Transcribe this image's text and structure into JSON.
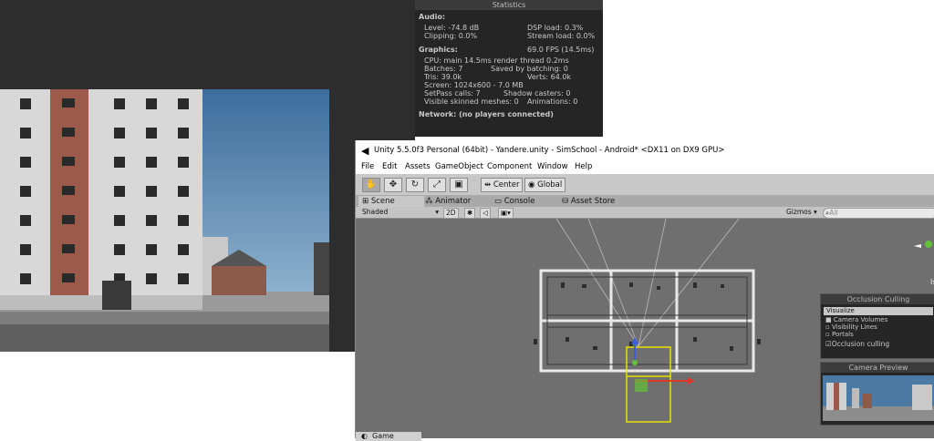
{
  "stats": {
    "title": "Statistics",
    "audio_header": "Audio:",
    "level": "Level: -74.8 dB",
    "dsp": "DSP load: 0.3%",
    "clipping": "Clipping: 0.0%",
    "stream": "Stream load: 0.0%",
    "graphics_header": "Graphics:",
    "fps": "69.0 FPS (14.5ms)",
    "cpu": "CPU: main 14.5ms  render thread 0.2ms",
    "batches": "Batches: 7",
    "saved": "Saved by batching: 0",
    "tris": "Tris: 39.0k",
    "verts": "Verts: 64.0k",
    "screen": "Screen: 1024x600 - 7.0 MB",
    "setpass": "SetPass calls: 7",
    "shadow": "Shadow casters: 0",
    "skinned": "Visible skinned meshes: 0",
    "animations": "Animations: 0",
    "network": "Network: (no players connected)"
  },
  "window": {
    "title": "Unity 5.5.0f3 Personal (64bit) - Yandere.unity - SimSchool - Android* <DX11 on DX9 GPU>"
  },
  "menu": [
    "File",
    "Edit",
    "Assets",
    "GameObject",
    "Component",
    "Window",
    "Help"
  ],
  "toolbar": {
    "pivot_center": "Center",
    "pivot_global": "Global",
    "icons": [
      "hand-icon",
      "move-icon",
      "rotate-icon",
      "scale-icon",
      "rect-icon"
    ]
  },
  "tabs": {
    "scene": "Scene",
    "animator": "Animator",
    "console": "Console",
    "asset_store": "Asset Store"
  },
  "scene_bar": {
    "shading": "Shaded",
    "mode_2d": "2D",
    "gizmos": "Gizmos",
    "search_placeholder": "All"
  },
  "occlusion": {
    "title": "Occlusion Culling",
    "section": "Visualize",
    "items": [
      "Camera Volumes",
      "Visibility Lines",
      "Portals"
    ],
    "toggle": "Occlusion culling"
  },
  "camera_preview": {
    "title": "Camera Preview"
  },
  "game_tab": "Game",
  "colors": {
    "accent_yellow": "#e8e000",
    "axis_red": "#d83a2a",
    "axis_green": "#63c23a",
    "axis_blue": "#3a5fd8"
  }
}
